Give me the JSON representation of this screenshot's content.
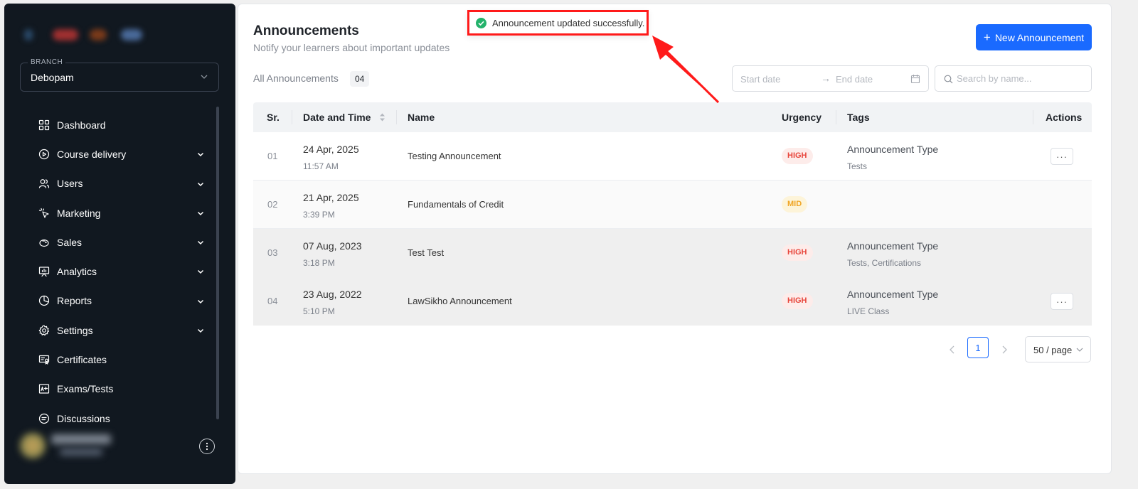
{
  "sidebar": {
    "branch_label": "BRANCH",
    "branch_value": "Debopam",
    "items": [
      {
        "label": "Dashboard",
        "icon": "dashboard-icon",
        "has_chevron": false
      },
      {
        "label": "Course delivery",
        "icon": "play-circle-icon",
        "has_chevron": true
      },
      {
        "label": "Users",
        "icon": "users-icon",
        "has_chevron": true
      },
      {
        "label": "Marketing",
        "icon": "cursor-click-icon",
        "has_chevron": true
      },
      {
        "label": "Sales",
        "icon": "piggy-bank-icon",
        "has_chevron": true
      },
      {
        "label": "Analytics",
        "icon": "presentation-chart-icon",
        "has_chevron": true
      },
      {
        "label": "Reports",
        "icon": "pie-chart-icon",
        "has_chevron": true
      },
      {
        "label": "Settings",
        "icon": "gear-icon",
        "has_chevron": true
      },
      {
        "label": "Certificates",
        "icon": "certificate-icon",
        "has_chevron": false
      },
      {
        "label": "Exams/Tests",
        "icon": "exam-icon",
        "has_chevron": false
      },
      {
        "label": "Discussions",
        "icon": "chat-icon",
        "has_chevron": false
      }
    ]
  },
  "header": {
    "title": "Announcements",
    "subtitle": "Notify your learners about important updates",
    "new_button": "New Announcement"
  },
  "filters": {
    "all_label": "All Announcements",
    "count": "04",
    "start_placeholder": "Start date",
    "end_placeholder": "End date",
    "search_placeholder": "Search by name..."
  },
  "table": {
    "columns": [
      "Sr.",
      "Date and Time",
      "Name",
      "Urgency",
      "Tags",
      "Actions"
    ],
    "rows": [
      {
        "sr": "01",
        "date": "24 Apr, 2025",
        "time": "11:57 AM",
        "name": "Testing Announcement",
        "urgency": "HIGH",
        "tag_type": "Announcement Type",
        "tags": "Tests",
        "has_action": true
      },
      {
        "sr": "02",
        "date": "21 Apr, 2025",
        "time": "3:39 PM",
        "name": "Fundamentals of Credit",
        "urgency": "MID",
        "tag_type": "",
        "tags": "",
        "has_action": false
      },
      {
        "sr": "03",
        "date": "07 Aug, 2023",
        "time": "3:18 PM",
        "name": "Test Test",
        "urgency": "HIGH",
        "tag_type": "Announcement Type",
        "tags": "Tests, Certifications",
        "has_action": false
      },
      {
        "sr": "04",
        "date": "23 Aug, 2022",
        "time": "5:10 PM",
        "name": "LawSikho Announcement",
        "urgency": "HIGH",
        "tag_type": "Announcement Type",
        "tags": "LIVE Class",
        "has_action": true
      }
    ]
  },
  "pagination": {
    "current_page": "1",
    "page_size": "50 / page"
  },
  "toast": {
    "message": "Announcement updated successfully."
  },
  "colors": {
    "accent": "#1a6aff",
    "sidebar_bg": "#111820",
    "high": "#e8463c",
    "mid": "#f0a626",
    "success": "#23b26b",
    "annotation": "#ff1a1a"
  }
}
